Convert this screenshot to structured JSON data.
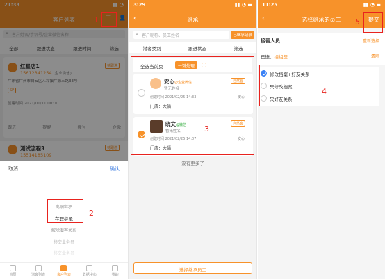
{
  "panel1": {
    "status_time": "21:33",
    "title": "客户列表",
    "search_placeholder": "客户姓名/手机号/企业微信名称",
    "filters": [
      "全部",
      "跟进状态",
      "跟进时间",
      "筛选"
    ],
    "card1": {
      "name": "红星店1",
      "phone": "15612341254",
      "phone_note": "(企业微信)",
      "addr": "广东省广州市白云区人和镇广源三路33号",
      "tag": "SP",
      "status": "待跟进",
      "time": "创建时间 2021/01/11 00:00",
      "actions": [
        "跟进",
        "提醒",
        "拨号",
        "企微"
      ]
    },
    "card2": {
      "name": "测试流程3",
      "phone": "15514185109",
      "status": "待跟进"
    },
    "sheet": {
      "cancel": "取消",
      "confirm": "确认",
      "items": [
        "离职继承",
        "在职继承",
        "解除潜客关系",
        "移交业务员",
        "移交业务员"
      ]
    },
    "tabs": [
      "首页",
      "潜客列表",
      "客户列表",
      "数据中心",
      "我的"
    ],
    "markers": {
      "one": "1",
      "two": "2"
    }
  },
  "panel2": {
    "status_time": "3:29",
    "title": "继承",
    "search_placeholder": "客户昵称、员工姓名",
    "record_btn": "已继承记录",
    "filters": [
      "潜客类别",
      "跟进状态",
      "筛选"
    ],
    "select_all": "全选当前页",
    "one_click": "一键处理",
    "customers": [
      {
        "name": "安心",
        "wx": "@企业微信",
        "badge": "自然客",
        "role": "暂无姓名",
        "created": "创建时间 2021/02/25 14:33",
        "owner": "安心",
        "store": "门店：大福"
      },
      {
        "name": "晓文",
        "wx": "@微信",
        "badge": "自然客",
        "role": "暂无姓名",
        "created": "创建时间 2021/02/25 14:07",
        "owner": "安心",
        "store": "门店：大福"
      }
    ],
    "no_more": "没有更多了",
    "bottom_btn": "选择继承员工",
    "marker": "3"
  },
  "panel3": {
    "status_time": "11:25",
    "title": "选择继承的员工",
    "submit": "提交",
    "heir_label": "接替人员",
    "reselect": "重新选择",
    "selected_prefix": "已选：",
    "selected_name": "接组签",
    "clear": "清除",
    "options": [
      {
        "label": "修改档案+好友关系",
        "on": true
      },
      {
        "label": "只修改档案",
        "on": false
      },
      {
        "label": "只好友关系",
        "on": false
      }
    ],
    "markers": {
      "four": "4",
      "five": "5"
    }
  }
}
